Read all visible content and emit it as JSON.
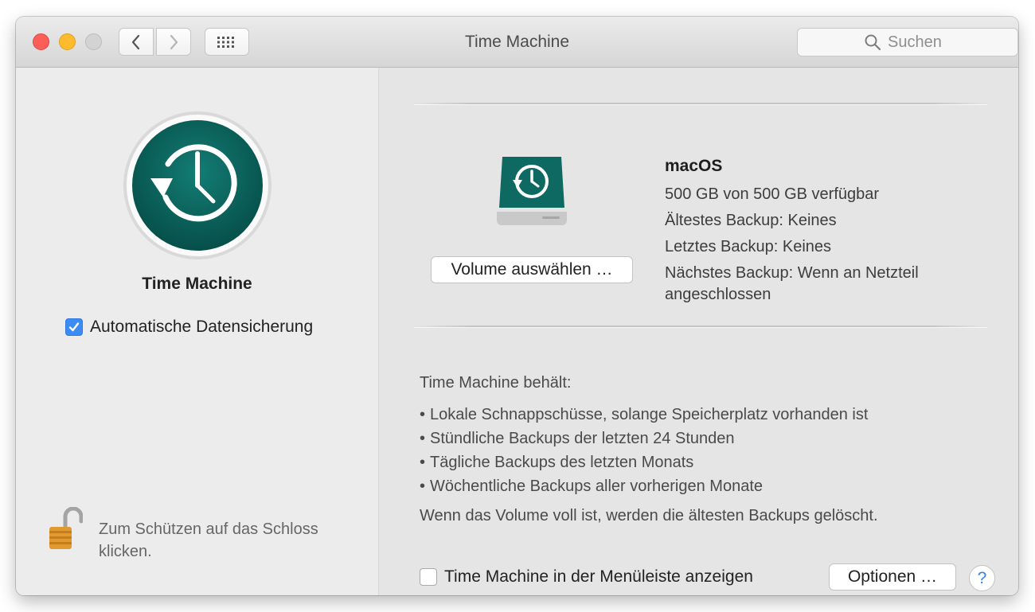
{
  "window": {
    "title": "Time Machine"
  },
  "toolbar": {
    "search_placeholder": "Suchen",
    "back_icon": "chevron-left-icon",
    "forward_icon": "chevron-right-icon",
    "grid_icon": "grid-icon",
    "search_icon": "magnifier-icon"
  },
  "sidebar": {
    "app_name": "Time Machine",
    "auto_backup_label": "Automatische Datensicherung",
    "auto_backup_checked": true,
    "lock_text": "Zum Schützen auf das Schloss klicken."
  },
  "volume": {
    "name": "macOS",
    "available": "500 GB von 500 GB verfügbar",
    "oldest": "Ältestes Backup: Keines",
    "latest": "Letztes Backup: Keines",
    "next": "Nächstes Backup: Wenn an Netzteil angeschlossen",
    "select_button": "Volume auswählen …"
  },
  "keeps": {
    "title": "Time Machine behält:",
    "items": [
      "Lokale Schnappschüsse, solange Speicherplatz vorhanden ist",
      "Stündliche Backups der letzten 24 Stunden",
      "Tägliche Backups des letzten Monats",
      "Wöchentliche Backups aller vorherigen Monate"
    ],
    "note": "Wenn das Volume voll ist, werden die ältesten Backups gelöscht."
  },
  "footer": {
    "menubar_label": "Time Machine in der Menüleiste anzeigen",
    "menubar_checked": false,
    "options_button": "Optionen …",
    "help_button": "?"
  },
  "colors": {
    "accent": "#3b8cf4",
    "time_machine_teal": "#0d6b63",
    "close": "#fc5f57",
    "minimize": "#fdbc2e",
    "zoom_inactive": "#d3d3d3"
  }
}
